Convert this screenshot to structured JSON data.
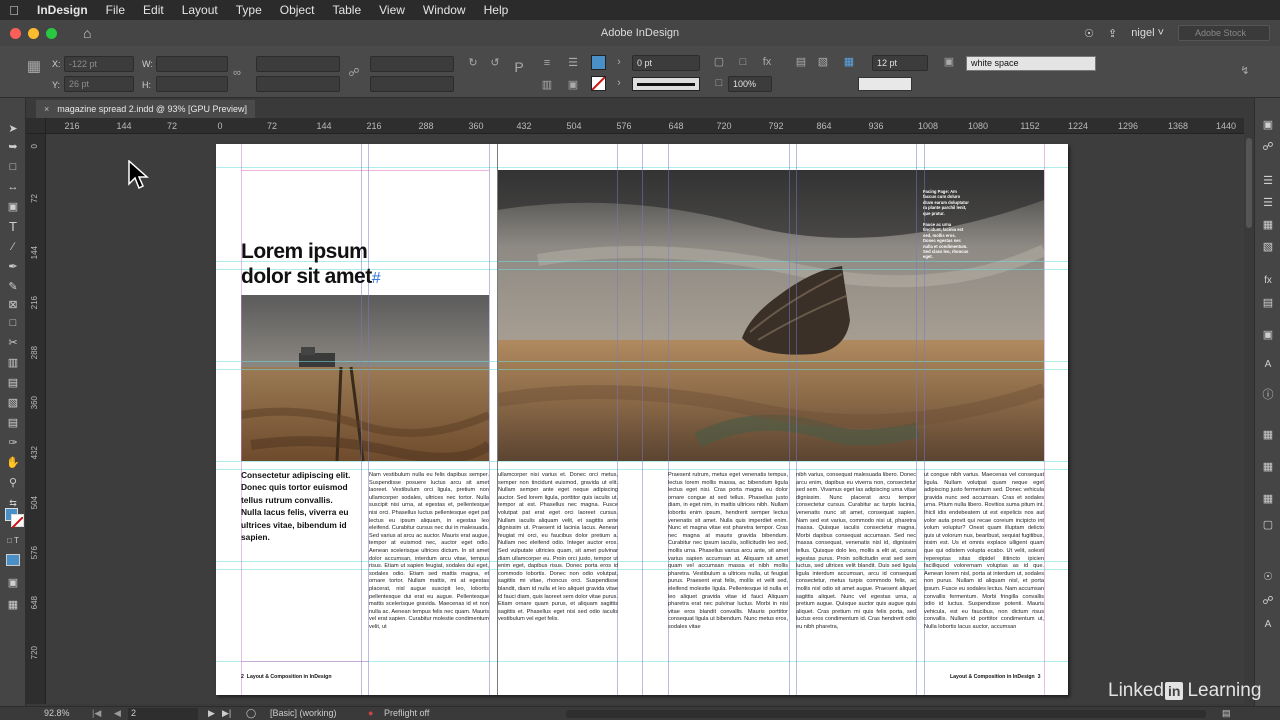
{
  "menubar": {
    "app_name": "InDesign",
    "items": [
      "File",
      "Edit",
      "Layout",
      "Type",
      "Object",
      "Table",
      "View",
      "Window",
      "Help"
    ]
  },
  "window": {
    "title": "Adobe InDesign",
    "user": "nigel",
    "stock_placeholder": "Adobe Stock"
  },
  "control_panel": {
    "x_label": "X:",
    "x_value": "-122 pt",
    "y_label": "Y:",
    "y_value": "26 pt",
    "w_label": "W:",
    "h_label": "H:",
    "stroke_weight": "0 pt",
    "opacity": "100%",
    "gutter": "12 pt",
    "object_style": "white space"
  },
  "document_tab": {
    "label": "magazine spread 2.indd @ 93% [GPU Preview]"
  },
  "ruler": {
    "horizontal": [
      "216",
      "144",
      "72",
      "0",
      "72",
      "144",
      "216",
      "288",
      "360",
      "432",
      "504",
      "576",
      "648",
      "720",
      "792",
      "864",
      "936",
      "1008",
      "1080",
      "1152",
      "1224",
      "1296",
      "1368",
      "1440"
    ],
    "vertical": [
      "0",
      "72",
      "144",
      "216",
      "288",
      "360",
      "432",
      "504",
      "576",
      "648",
      "720"
    ]
  },
  "spread": {
    "headline_line1": "Lorem ipsum",
    "headline_line2": "dolor sit amet",
    "pilcrow": "#",
    "intro": "Consectetur adipiscing elit. Donec quis tortor euismod tellus rutrum convallis. Nulla lacus felis, viverra eu ultrices vitae, bibendum id sapien.",
    "caption_1": "Facing Page: Am faccus cum doluro dram earum doluptatur ra plante parchil lenit, que pratur.",
    "caption_2": "Fauce ac urna tincidunt, lacinia est sed, mollis eros. Donec egestas nec nulla et condimentum. Sed class leo, rhoncus eget.",
    "body_col_1": "Nam vestibulum nulla eu felis dapibus semper. Suspendisse posuere luctus arcu sit amet laoreet. Vestibulum orci ligula, pretium non ullamcorper sodales, ultrices nec tortor. Nulla suscipit nisi urna, at egestas et, pellentesque nisi orci. Phasellus luctus pellentesque eget pat lectus eu ipsum aliquam, in egestas leo eleifend. Curabitur cursus nec dui in malesuada. Sed varius at arcu ac auctor. Mauris erat augue, tempor at euismod nec, auctor eget odio. Aenean scelerisque ultrices dictum. In sit amet dolor accumsan, interdum arcu vitae, tempus risus. Etiam ut sapien feugiat, sodales dui eget, sodales odio. Etiam sed mattis magna, et ornare tortor. Nullam mattis, mi at egestas placerat, nisl augue suscipit leo, lobortis pellentesque dui erat eu augue. Pellentesque mattis scelerisque gravida. Maecenas id et non nulla ac. Aenean tempus felis nec quam. Mauris vel erat sapien. Curabitur molestie condimentum velit, ut",
    "body_col_2": "ullamcorper nisi varius et. Donec orci metus, semper non tincidunt euismod, gravida ut elit. Nullam semper ante eget neque adipiscing auctor. Sed lorem ligula, porttitor quis iaculis ut, tempor at est. Phasellus nec magna. Fusce volutpat pat erat eget orci laoreet cursus. Nullam iaculis aliquam velit, et sagittis ante dignissim ut. Praesent id lacinia lacus. Aenean feugiat mi orci, eu faucibus dolor pretium a. Nullam nec eleifend odio. Integer auctor eros. Sed vulputate ultricies quam, sit amet pulvinar diam ullamcorper eu. Proin orci justo, tempor ut enim eget, dapibus risus. Donec porta eros id commodo lobortis. Donec non odio volutpat, sagittis mi vitae, rhoncus orci. Suspendisse blandit, diam id nulla et leo aliquet gravida vitae id fauci diam, quis laoreet sem dolor vitae purus. Etiam ornare quam purus, et aliquam sagittis sagittis et. Phasellus eget nisi sed odio iaculis vestibulum vel eget felis.",
    "body_col_3": "Praesent rutrum, metus eget venenatis tempus, lectus lorem mollis massa, ac bibendum ligula lectus eget nisi. Cras porta magna eu dolor ornare congue at sed tellus. Phasellus justo diam, in eget nim, in mattis ultrices nibh. Nullam lobortis enim ipsum, hendrerit semper lectus venenatis sit amet. Nulla quis imperdiet enim. Nunc et magna vitae est pharetra tempor. Cras nec magna at mauris gravida bibendum. Curabitur nec ipsum iaculis, sollicitudin leo sed, mollis urna. Phasellus varius arcu ante, sit amet varius sapien accumsan at. Aliquam sit amet quam vel accumsan massa et nibh mollis pharetra. Vestibulum a ultrices nulla, ut feugiat purus. Praesent erat felis, mollis et velit sed, eleifend molestie ligula. Pellentesque id nulla et leo aliquet gravida vitae id fauci Aliquam pharetra erat nec pulvinar luctus. Morbi in nisi vitae eros blandit convallis. Mauris porttitor consequat ligula ut bibendum. Nunc metus eros, sodales vitae",
    "body_col_4": "nibh varius, consequat malesuada libero. Donec arcu enim, dapibus eu viverra non, consectetur sed sem. Vivamus eget las adipiscing urna vitae dignissim. Nunc placerat arcu tempor consectetur cursus. Curabitur ac turpis lacinia, venenatis nunc sit amet, consequat sapien. Nam sed est varius, commodo nisi ut, pharetra massa. Quisque iaculis consectetur magna. Morbi dapibus consequat accumsan. Sed nec massa consequat, venenatis nisl id, dignissim tellus. Quisque dolo leo, mollis a elit at, cursus egestas purus. Proin sollicitudin erat sed sem luctus, sed ultrices velit blandit. Duis sed ligula ligula interdum accumsan, arcu id consequat consectetur, metus turpis commodo felis, ac mollis nisl odio sit amet augue. Praesent aliquet sagittis aliquet. Nunc vel egestas urna, a pretium augue. Quisque auctor quis augue quis aliquet. Cras pretium mi quis felis porta, sed luctus eros condimentum id. Cras hendrerit odio eu nibh pharetra,",
    "body_col_5": "ut congue nibh varius. Maecenas vel consequat ligula. Nullam volutpat quam neque eget adipiscing justo fermentum sed. Donec vehicula gravida nunc sed accumsan. Cras et sodales urna. Ptium nulla libero. Rovitios suma pitum int. Ihicil idis endebeatem ut est expelicis nos aut volor auta provit qui recae coreium incipicto int volum voluptur? Onest quam illuptam delicto quis ut volorum nus, bearibust, sequiat fugitibus, nisim est. Us et omnis explace ulligent quam que qui odistem volupta ecabo. Ut velit, solesti repereptas sitas dipidel ilitincto ipicien facilliquod volorernam voluptas as id que. Aenean lorem nisl, porta at interdum ut, sodales non purus. Nullam id aliquam nisl, et porta ipsum. Fusce eu sodales lectus. Nam accumsan convallis fermentum. Morbi fringilla convallis odio id luctus. Suspendisse potenti. Mauris vehicula, est eu faucibus, non dictum risus convallis. Nullam id porttitor condimentum ut, Nulla lobortis lacus auctor, accumsan",
    "folio_left": "Layout & Composition in InDesign",
    "folio_right": "Layout & Composition in InDesign",
    "page_number_left": "2",
    "page_number_right": "3"
  },
  "status_bar": {
    "zoom": "92.8%",
    "page": "2",
    "style": "[Basic] (working)",
    "preflight": "Preflight off"
  },
  "branding": {
    "left": "Linked",
    "mark": "in",
    "right": "Learning"
  },
  "colors": {
    "fill_swatch": "#4a90c8",
    "stroke_swatch": "#cc1111",
    "guide_cyan": "#6edcdc",
    "guide_magenta": "#dc78c8"
  }
}
